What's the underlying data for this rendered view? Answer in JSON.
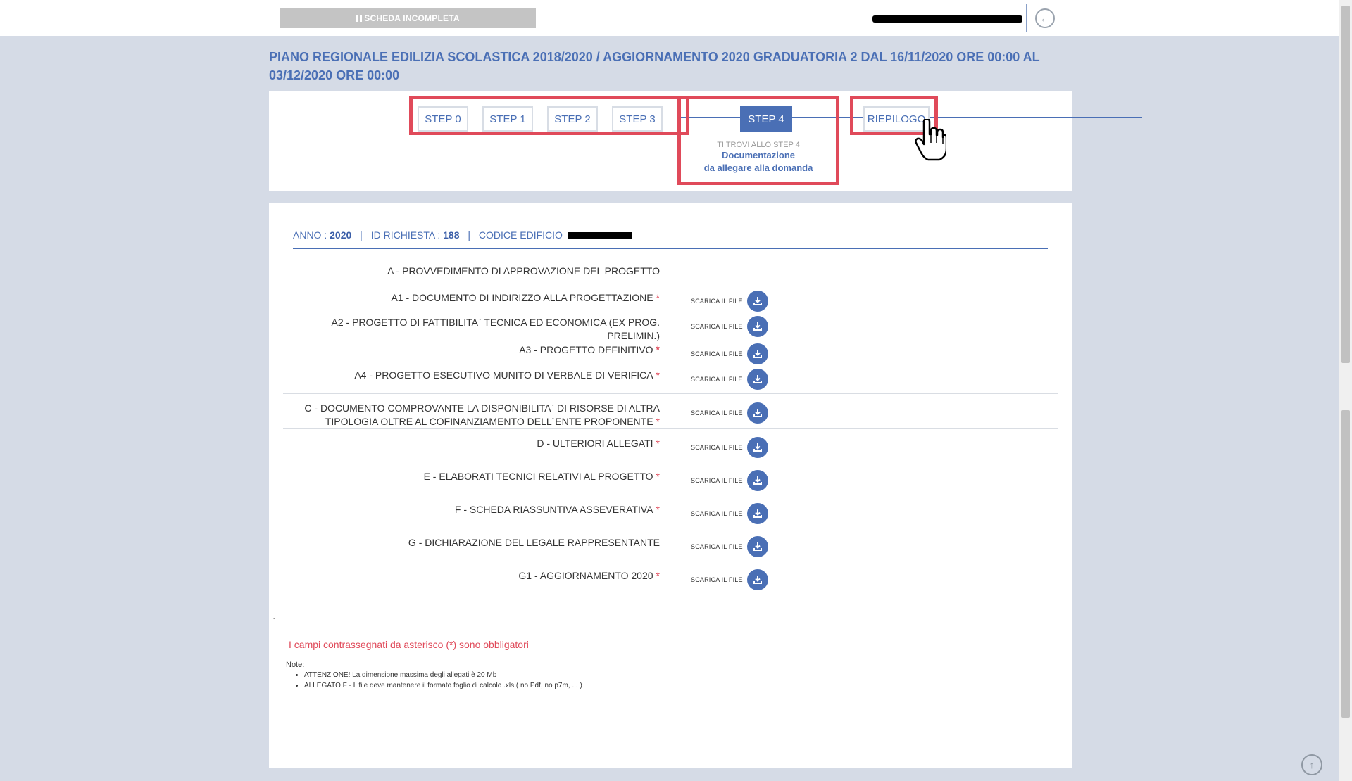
{
  "topbar": {
    "status_label": "SCHEDA INCOMPLETA"
  },
  "page": {
    "title": "PIANO REGIONALE EDILIZIA SCOLASTICA 2018/2020 / AGGIORNAMENTO 2020 GRADUATORIA 2 DAL 16/11/2020 ORE 00:00 AL 03/12/2020 ORE 00:00"
  },
  "steps": {
    "items": [
      "STEP 0",
      "STEP 1",
      "STEP 2",
      "STEP 3",
      "STEP 4",
      "RIEPILOGO"
    ],
    "active": "STEP 4",
    "info_small": "TI TROVI ALLO STEP 4",
    "info_line1": "Documentazione",
    "info_line2": "da allegare alla domanda"
  },
  "meta": {
    "anno_label": "ANNO :",
    "anno_value": "2020",
    "id_label": "ID RICHIESTA :",
    "id_value": "188",
    "codice_label": "CODICE EDIFICIO"
  },
  "documents": {
    "download_label": "SCARICA IL FILE",
    "section_a": "A - PROVVEDIMENTO DI APPROVAZIONE DEL PROGETTO",
    "a1": "A1 - DOCUMENTO DI INDIRIZZO ALLA PROGETTAZIONE",
    "a2": "A2 - PROGETTO DI FATTIBILITA` TECNICA ED ECONOMICA (EX PROG. PRELIMIN.)",
    "a3": "A3 - PROGETTO DEFINITIVO",
    "a4": "A4 - PROGETTO ESECUTIVO MUNITO DI VERBALE DI VERIFICA",
    "c": "C - DOCUMENTO COMPROVANTE LA DISPONIBILITA` DI RISORSE DI ALTRA TIPOLOGIA OLTRE AL COFINANZIAMENTO DELL`ENTE PROPONENTE",
    "d": "D - ULTERIORI ALLEGATI",
    "e": "E - ELABORATI TECNICI RELATIVI AL PROGETTO",
    "f": "F - SCHEDA RIASSUNTIVA ASSEVERATIVA",
    "g": "G - DICHIARAZIONE DEL LEGALE RAPPRESENTANTE",
    "g1": "G1 - AGGIORNAMENTO 2020",
    "required_mark": "*"
  },
  "footer": {
    "dot": "-",
    "mandatory_note": "I campi contrassegnati da asterisco (*) sono obbligatori",
    "notes_title": "Note:",
    "notes": [
      "ATTENZIONE! La dimensione massima degli allegati è 20 Mb",
      "ALLEGATO F - Il file deve mantenere il formato foglio di calcolo .xls ( no Pdf, no p7m, ... )"
    ]
  },
  "colors": {
    "accent": "#4a6fb5",
    "highlight": "#e04a5a",
    "background": "#d5dbe6"
  }
}
